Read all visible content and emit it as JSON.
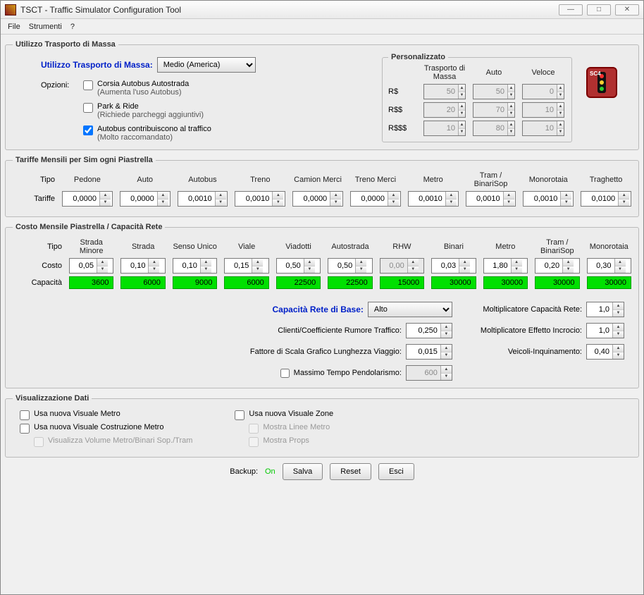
{
  "window": {
    "title": "TSCT - Traffic Simulator Configuration Tool"
  },
  "menu": {
    "file": "File",
    "tools": "Strumenti",
    "help": "?"
  },
  "massTransit": {
    "legend": "Utilizzo Trasporto di Massa",
    "usageLabel": "Utilizzo Trasporto di Massa:",
    "usageValue": "Medio (America)",
    "optionsLabel": "Opzioni:",
    "opt1": "Corsia Autobus Autostrada",
    "opt1sub": "(Aumenta l'uso Autobus)",
    "opt2": "Park & Ride",
    "opt2sub": "(Richiede parcheggi aggiuntivi)",
    "opt3": "Autobus contribuiscono al traffico",
    "opt3sub": "(Molto raccomandato)",
    "custom": {
      "legend": "Personalizzato",
      "colMass": "Trasporto di Massa",
      "colAuto": "Auto",
      "colSpeed": "Veloce",
      "r1": "R$",
      "r2": "R$$",
      "r3": "R$$$",
      "v": [
        [
          "50",
          "50",
          "0"
        ],
        [
          "20",
          "70",
          "10"
        ],
        [
          "10",
          "80",
          "10"
        ]
      ]
    }
  },
  "fares": {
    "legend": "Tariffe Mensili per Sim ogni Piastrella",
    "rowType": "Tipo",
    "rowFare": "Tariffe",
    "cols": [
      "Pedone",
      "Auto",
      "Autobus",
      "Treno",
      "Camion Merci",
      "Treno Merci",
      "Metro",
      "Tram / BinariSop",
      "Monorotaia",
      "Traghetto"
    ],
    "vals": [
      "0,0000",
      "0,0000",
      "0,0010",
      "0,0010",
      "0,0000",
      "0,0000",
      "0,0010",
      "0,0010",
      "0,0010",
      "0,0100"
    ]
  },
  "cost": {
    "legend": "Costo Mensile Piastrella / Capacità Rete",
    "rowType": "Tipo",
    "rowCost": "Costo",
    "rowCap": "Capacità",
    "cols": [
      "Strada Minore",
      "Strada",
      "Senso Unico",
      "Viale",
      "Viadotti",
      "Autostrada",
      "RHW",
      "Binari",
      "Metro",
      "Tram / BinariSop",
      "Monorotaia"
    ],
    "costs": [
      "0,05",
      "0,10",
      "0,10",
      "0,15",
      "0,50",
      "0,50",
      "0,00",
      "0,03",
      "1,80",
      "0,20",
      "0,30"
    ],
    "caps": [
      "3600",
      "6000",
      "9000",
      "6000",
      "22500",
      "22500",
      "15000",
      "30000",
      "30000",
      "30000",
      "30000"
    ],
    "baseCapLabel": "Capacità Rete di Base:",
    "baseCapValue": "Alto",
    "noiseLabel": "Clienti/Coefficiente Rumore Traffico:",
    "noiseVal": "0,250",
    "scaleLabel": "Fattore di Scala Grafico Lunghezza Viaggio:",
    "scaleVal": "0,015",
    "commuteLabel": "Massimo Tempo Pendolarismo:",
    "commuteVal": "600",
    "multCapLabel": "Moltiplicatore Capacità Rete:",
    "multCapVal": "1,0",
    "multIntLabel": "Moltiplicatore Effetto Incrocio:",
    "multIntVal": "1,0",
    "vehPollLabel": "Veicoli-Inquinamento:",
    "vehPollVal": "0,40"
  },
  "dataView": {
    "legend": "Visualizzazione Dati",
    "c1": "Usa nuova Visuale Metro",
    "c2": "Usa nuova Visuale Costruzione Metro",
    "c3": "Visualizza Volume Metro/Binari Sop./Tram",
    "c4": "Usa nuova Visuale Zone",
    "c5": "Mostra Linee Metro",
    "c6": "Mostra Props"
  },
  "footer": {
    "backupLabel": "Backup:",
    "backupState": "On",
    "save": "Salva",
    "reset": "Reset",
    "exit": "Esci"
  }
}
